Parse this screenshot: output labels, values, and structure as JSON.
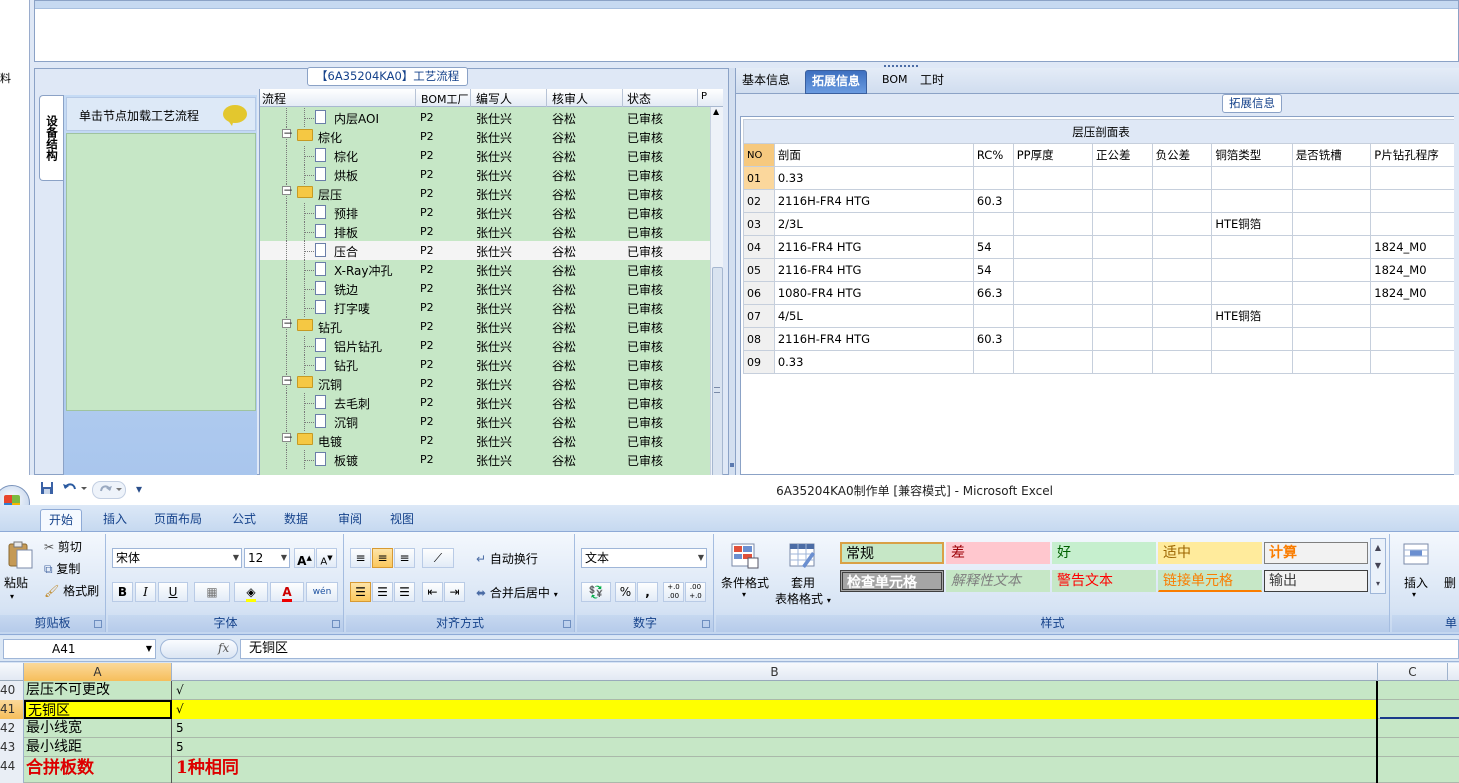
{
  "top": {
    "left_strip_char": "料",
    "flow_panel": {
      "title": "【6A35204KA0】工艺流程",
      "side_tab": "设备结构",
      "hint": "单击节点加载工艺流程",
      "columns": [
        "流程",
        "BOM工厂",
        "编写人",
        "核审人",
        "状态",
        "P"
      ],
      "rows": [
        {
          "name": "内层AOI",
          "level": 2,
          "bom": "P2",
          "writer": "张仕兴",
          "reviewer": "谷松",
          "status": "已审核"
        },
        {
          "name": "棕化",
          "level": 1,
          "bom": "P2",
          "writer": "张仕兴",
          "reviewer": "谷松",
          "status": "已审核"
        },
        {
          "name": "棕化",
          "level": 2,
          "bom": "P2",
          "writer": "张仕兴",
          "reviewer": "谷松",
          "status": "已审核"
        },
        {
          "name": "烘板",
          "level": 2,
          "bom": "P2",
          "writer": "张仕兴",
          "reviewer": "谷松",
          "status": "已审核"
        },
        {
          "name": "层压",
          "level": 1,
          "bom": "P2",
          "writer": "张仕兴",
          "reviewer": "谷松",
          "status": "已审核"
        },
        {
          "name": "预排",
          "level": 2,
          "bom": "P2",
          "writer": "张仕兴",
          "reviewer": "谷松",
          "status": "已审核"
        },
        {
          "name": "排板",
          "level": 2,
          "bom": "P2",
          "writer": "张仕兴",
          "reviewer": "谷松",
          "status": "已审核"
        },
        {
          "name": "压合",
          "level": 2,
          "bom": "P2",
          "writer": "张仕兴",
          "reviewer": "谷松",
          "status": "已审核",
          "selected": true
        },
        {
          "name": "X-Ray冲孔",
          "level": 2,
          "bom": "P2",
          "writer": "张仕兴",
          "reviewer": "谷松",
          "status": "已审核"
        },
        {
          "name": "铣边",
          "level": 2,
          "bom": "P2",
          "writer": "张仕兴",
          "reviewer": "谷松",
          "status": "已审核"
        },
        {
          "name": "打字唛",
          "level": 2,
          "bom": "P2",
          "writer": "张仕兴",
          "reviewer": "谷松",
          "status": "已审核"
        },
        {
          "name": "钻孔",
          "level": 1,
          "bom": "P2",
          "writer": "张仕兴",
          "reviewer": "谷松",
          "status": "已审核"
        },
        {
          "name": "铝片钻孔",
          "level": 2,
          "bom": "P2",
          "writer": "张仕兴",
          "reviewer": "谷松",
          "status": "已审核"
        },
        {
          "name": "钻孔",
          "level": 2,
          "bom": "P2",
          "writer": "张仕兴",
          "reviewer": "谷松",
          "status": "已审核"
        },
        {
          "name": "沉铜",
          "level": 1,
          "bom": "P2",
          "writer": "张仕兴",
          "reviewer": "谷松",
          "status": "已审核"
        },
        {
          "name": "去毛刺",
          "level": 2,
          "bom": "P2",
          "writer": "张仕兴",
          "reviewer": "谷松",
          "status": "已审核"
        },
        {
          "name": "沉铜",
          "level": 2,
          "bom": "P2",
          "writer": "张仕兴",
          "reviewer": "谷松",
          "status": "已审核"
        },
        {
          "name": "电镀",
          "level": 1,
          "bom": "P2",
          "writer": "张仕兴",
          "reviewer": "谷松",
          "status": "已审核"
        },
        {
          "name": "板镀",
          "level": 2,
          "bom": "P2",
          "writer": "张仕兴",
          "reviewer": "谷松",
          "status": "已审核"
        }
      ]
    },
    "right_panel": {
      "tabs": [
        {
          "label": "基本信息",
          "active": false
        },
        {
          "label": "拓展信息",
          "active": true
        },
        {
          "label": "BOM",
          "active": false
        },
        {
          "label": "工时",
          "active": false
        }
      ],
      "group_title": "拓展信息",
      "table_caption": "层压剖面表",
      "columns": [
        "NO",
        "剖面",
        "RC%",
        "PP厚度",
        "正公差",
        "负公差",
        "铜箔类型",
        "是否铣槽",
        "P片钻孔程序"
      ],
      "rows": [
        [
          "01",
          "0.33",
          "",
          "",
          "",
          "",
          "",
          "",
          ""
        ],
        [
          "02",
          "2116H-FR4 HTG",
          "60.3",
          "",
          "",
          "",
          "",
          "",
          ""
        ],
        [
          "03",
          "2/3L",
          "",
          "",
          "",
          "",
          "HTE铜箔",
          "",
          ""
        ],
        [
          "04",
          "2116-FR4 HTG",
          "54",
          "",
          "",
          "",
          "",
          "",
          "1824_M0"
        ],
        [
          "05",
          "2116-FR4 HTG",
          "54",
          "",
          "",
          "",
          "",
          "",
          "1824_M0"
        ],
        [
          "06",
          "1080-FR4 HTG",
          "66.3",
          "",
          "",
          "",
          "",
          "",
          "1824_M0"
        ],
        [
          "07",
          "4/5L",
          "",
          "",
          "",
          "",
          "HTE铜箔",
          "",
          ""
        ],
        [
          "08",
          "2116H-FR4 HTG",
          "60.3",
          "",
          "",
          "",
          "",
          "",
          ""
        ],
        [
          "09",
          "0.33",
          "",
          "",
          "",
          "",
          "",
          "",
          ""
        ]
      ]
    }
  },
  "excel": {
    "window_title": "6A35204KA0制作单  [兼容模式] - Microsoft Excel",
    "qat_dropdown": "▾",
    "ribbon_tabs": [
      {
        "label": "开始",
        "active": true
      },
      {
        "label": "插入",
        "active": false
      },
      {
        "label": "页面布局",
        "active": false
      },
      {
        "label": "公式",
        "active": false
      },
      {
        "label": "数据",
        "active": false
      },
      {
        "label": "审阅",
        "active": false
      },
      {
        "label": "视图",
        "active": false
      }
    ],
    "clipboard": {
      "paste": "粘贴",
      "cut": "剪切",
      "copy": "复制",
      "painter": "格式刷",
      "label": "剪贴板"
    },
    "font": {
      "name": "宋体",
      "size": "12",
      "grow": "A",
      "shrink": "A",
      "bold": "B",
      "italic": "I",
      "underline": "U",
      "font_color": "A",
      "phonetic": "wén",
      "label": "字体"
    },
    "alignment": {
      "wrap": "自动换行",
      "merge": "合并后居中",
      "label": "对齐方式"
    },
    "number": {
      "format": "文本",
      "percent": "%",
      "comma": ",",
      "inc": "+.0 .00",
      "dec": ".00 +.0",
      "label": "数字"
    },
    "styles": {
      "cond_format_line1": "条件格式",
      "table_format_line1": "套用",
      "table_format_line2": "表格格式",
      "cells": [
        {
          "text": "常规",
          "bg": "#c6e7c6",
          "fg": "#000000",
          "border": "#d9a146"
        },
        {
          "text": "差",
          "bg": "#ffc7ce",
          "fg": "#9c0006",
          "border": "#ffc7ce"
        },
        {
          "text": "好",
          "bg": "#c6efce",
          "fg": "#006100",
          "border": "#c6efce"
        },
        {
          "text": "适中",
          "bg": "#ffeb9c",
          "fg": "#9c6500",
          "border": "#ffeb9c"
        },
        {
          "text": "计算",
          "bg": "#f2f2f2",
          "fg": "#fa7d00",
          "border": "#7f7f7f"
        },
        {
          "text": "检查单元格",
          "bg": "#a5a5a5",
          "fg": "#ffffff",
          "border": "#3f3f3f"
        },
        {
          "text": "解释性文本",
          "bg": "#c6e7c6",
          "fg": "#7f7f7f",
          "border": "#c6e7c6"
        },
        {
          "text": "警告文本",
          "bg": "#c6e7c6",
          "fg": "#ff0000",
          "border": "#c6e7c6"
        },
        {
          "text": "链接单元格",
          "bg": "#c6e7c6",
          "fg": "#fa7d00",
          "border": "#c6e7c6"
        },
        {
          "text": "输出",
          "bg": "#f2f2f2",
          "fg": "#3f3f3f",
          "border": "#3f3f3f"
        }
      ],
      "label": "样式"
    },
    "cells_group": {
      "insert": "插入",
      "delete": "删",
      "label": "单"
    },
    "name_box": "A41",
    "fx": "fx",
    "formula": "无铜区",
    "col_headers": [
      "A",
      "B",
      "C"
    ],
    "rows": [
      {
        "num": "40",
        "a": "层压不可更改",
        "b": "√"
      },
      {
        "num": "41",
        "a": "无铜区",
        "b": "√",
        "selected": true
      },
      {
        "num": "42",
        "a": "最小线宽",
        "b": "5"
      },
      {
        "num": "43",
        "a": "最小线距",
        "b": "5"
      },
      {
        "num": "44",
        "a": "合拼板数",
        "b": "1种相同",
        "emphasis": true
      }
    ]
  }
}
